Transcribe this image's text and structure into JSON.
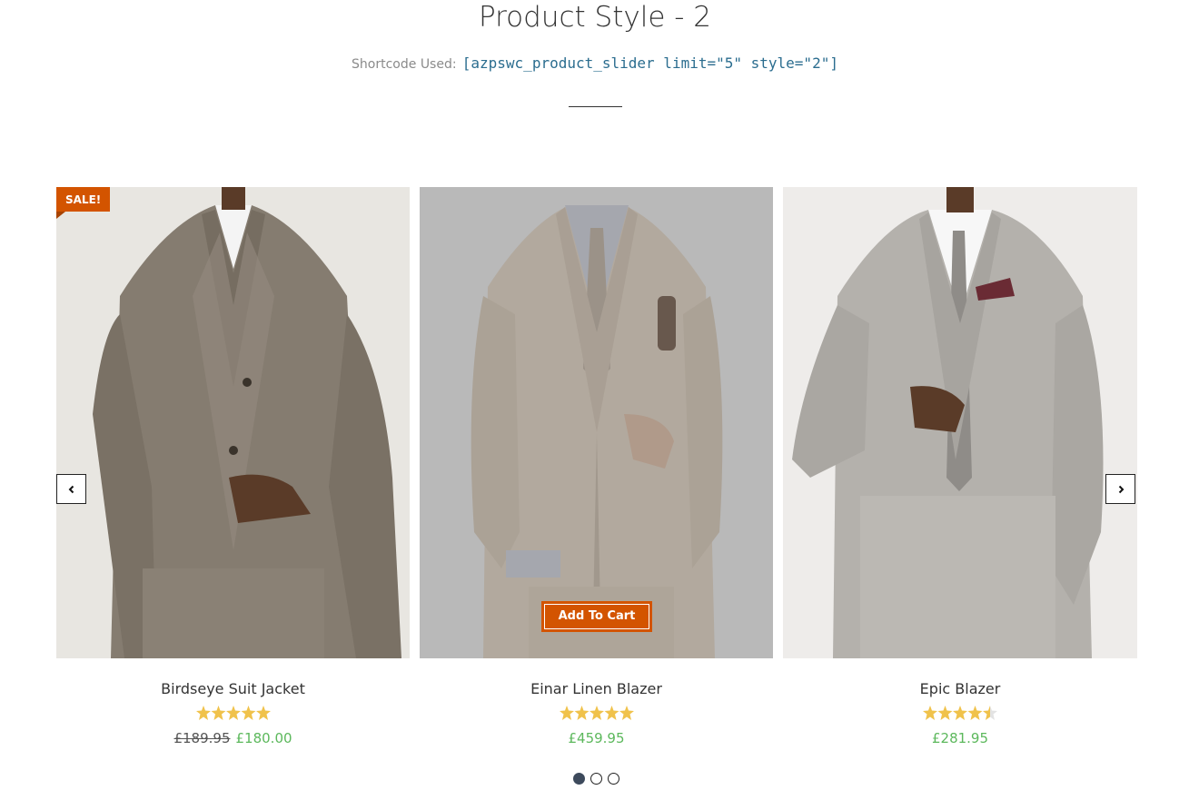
{
  "header": {
    "title": "Product Style - 2",
    "shortcode_label": "Shortcode Used:",
    "shortcode_code": "[azpswc_product_slider limit=\"5\" style=\"2\"]"
  },
  "colors": {
    "accent": "#d35400",
    "price_sale": "#5cb85c",
    "star": "#f0c24b",
    "code": "#2b6d8f"
  },
  "slider": {
    "prev_icon": "chevron-left-icon",
    "next_icon": "chevron-right-icon",
    "dots": 3,
    "active_dot": 1,
    "products": [
      {
        "name": "Birdseye Suit Jacket",
        "badge": "SALE!",
        "rating": 5,
        "price_old": "£189.95",
        "price": "£180.00"
      },
      {
        "name": "Einar Linen Blazer",
        "rating": 5,
        "price": "£459.95",
        "button": "Add To Cart"
      },
      {
        "name": "Epic Blazer",
        "rating": 4.5,
        "price": "£281.95"
      }
    ]
  }
}
